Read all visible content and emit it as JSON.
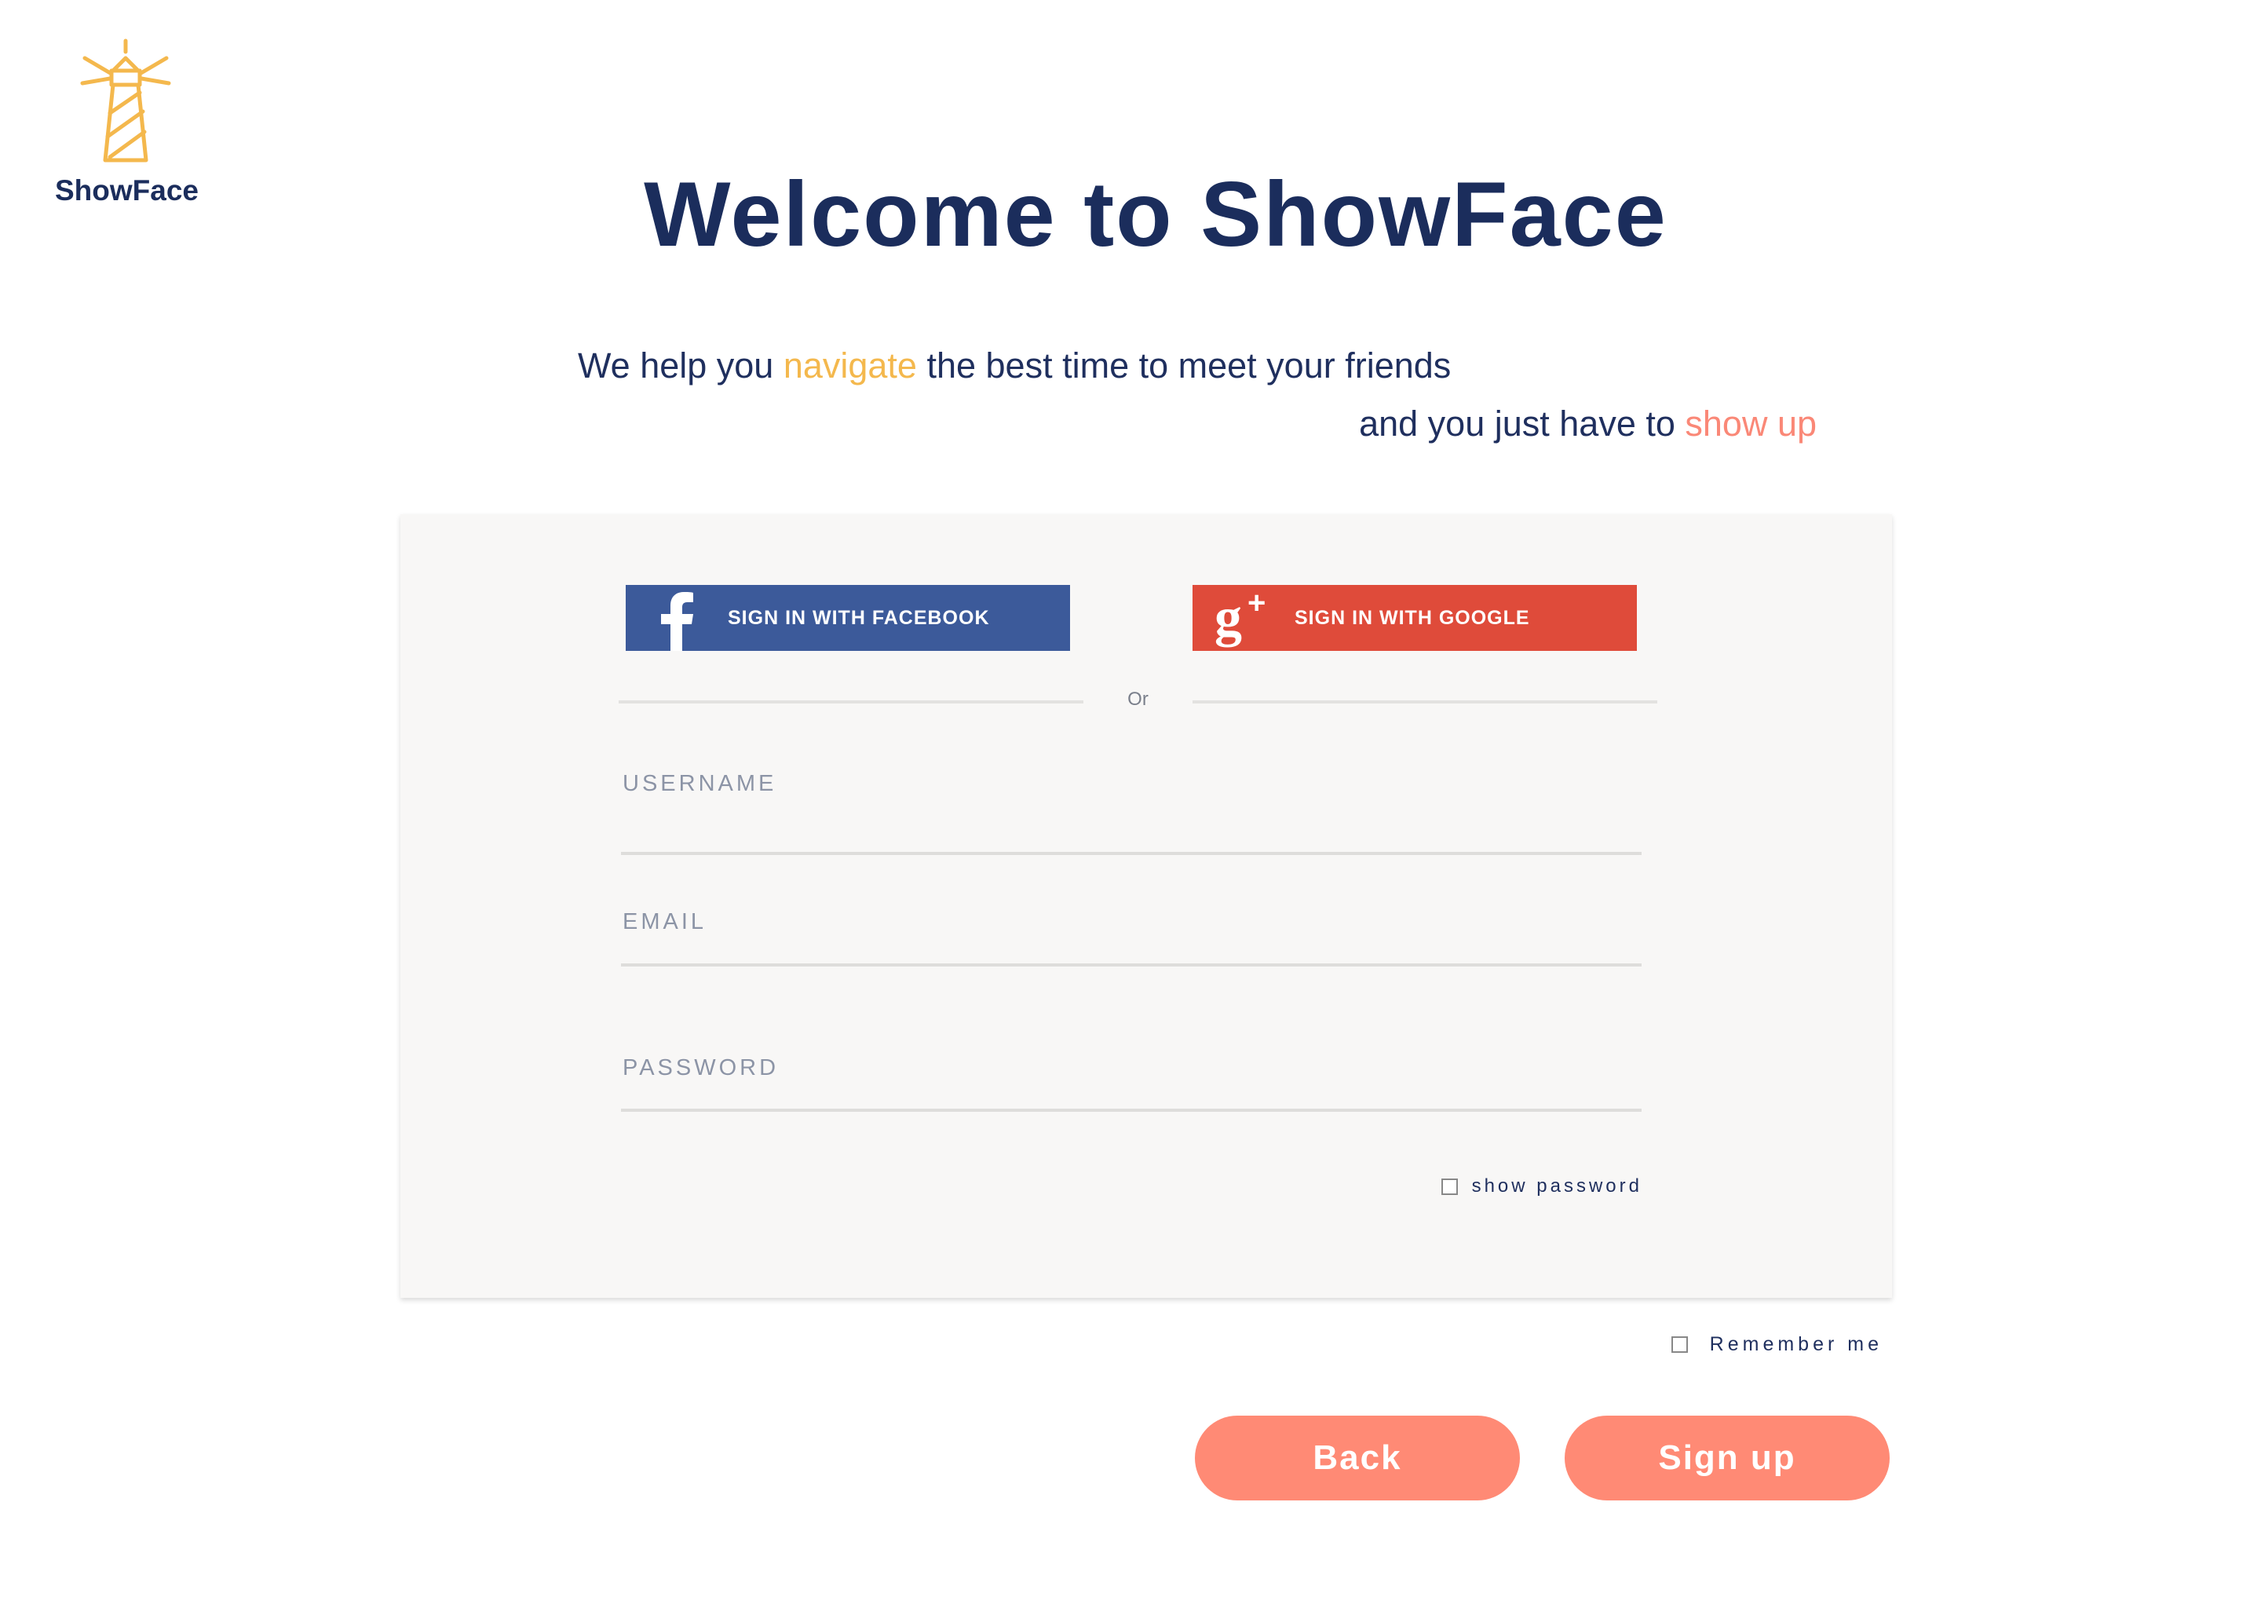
{
  "brand": {
    "name": "ShowFace",
    "logo_icon": "lighthouse-icon",
    "logo_color": "#f4b84d"
  },
  "header": {
    "title": "Welcome to ShowFace"
  },
  "tagline": {
    "line1_pre": "We help you ",
    "line1_highlight": "navigate",
    "line1_post": " the best time to meet your friends",
    "line2_pre": "and you just have to ",
    "line2_highlight": "show up"
  },
  "social": {
    "facebook": {
      "label": "SIGN IN WITH FACEBOOK",
      "icon": "facebook-icon",
      "color": "#3c5a9a"
    },
    "google": {
      "label": "SIGN IN WITH GOOGLE",
      "icon": "google-plus-icon",
      "color": "#df4b3a"
    }
  },
  "divider_text": "Or",
  "form": {
    "username_label": "USERNAME",
    "username_value": "",
    "email_label": "EMAIL",
    "email_value": "",
    "password_label": "PASSWORD",
    "password_value": "",
    "show_password_label": "show password",
    "show_password_checked": false
  },
  "remember_me": {
    "label": "Remember me",
    "checked": false
  },
  "actions": {
    "back_label": "Back",
    "signup_label": "Sign up",
    "button_color": "#ff8a75"
  }
}
